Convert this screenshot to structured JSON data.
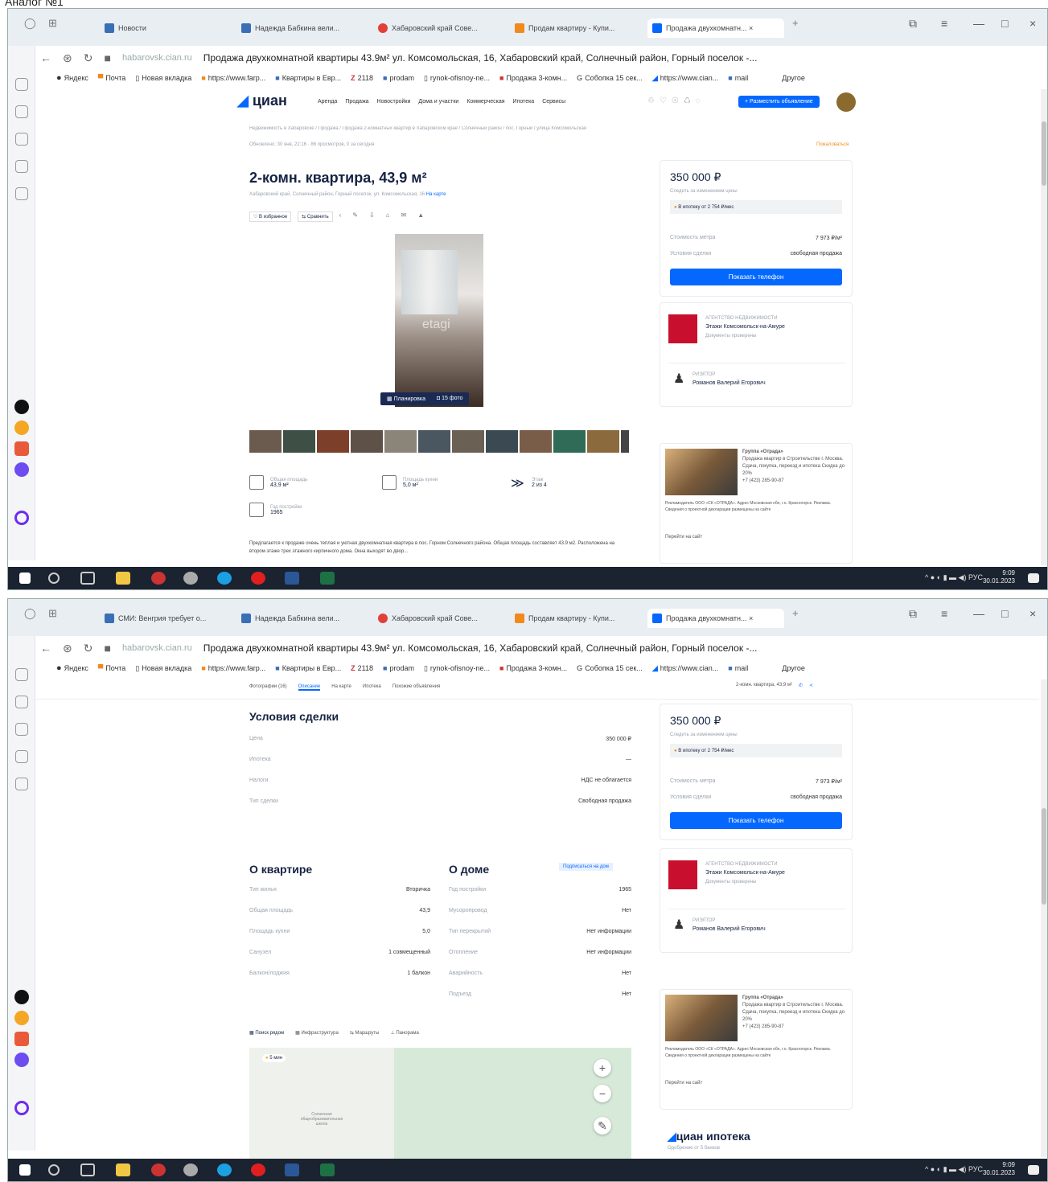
{
  "caption": "Аналог №1",
  "browser": {
    "tabs_top": [
      "Новости",
      "Надежда Бабкина вели...",
      "Хабаровский край Сове...",
      "Продам квартиру - Купи...",
      "Продажа двухкомнатн... ×"
    ],
    "tabs_bottom": [
      "СМИ: Венгрия требует о...",
      "Надежда Бабкина вели...",
      "Хабаровский край Сове...",
      "Продам квартиру - Купи...",
      "Продажа двухкомнатн... ×"
    ],
    "url_host": "habarovsk.cian.ru",
    "url_title": "Продажа двухкомнатной квартиры 43.9м² ул. Комсомольская, 16, Хабаровский край, Солнечный район, Горный поселок -...",
    "bookmarks": [
      "Яндекс",
      "Почта",
      "Новая вкладка",
      "https://www.farp...",
      "Квартиры в Евр...",
      "2118",
      "prodam",
      "rynok-ofisnoy-ne...",
      "Продажа 3-комн...",
      "Собопка 15 сек...",
      "https://www.cian...",
      "mail"
    ],
    "bookmarks_other": "Другое",
    "plus_tab": "+",
    "win_controls": [
      "—",
      "□",
      "×"
    ]
  },
  "taskbar": {
    "lang": "РУС",
    "time": "9:09",
    "date": "30.01.2023"
  },
  "cian": {
    "logo": "циан",
    "nav": [
      "Аренда",
      "Продажа",
      "Новостройки",
      "Дома и участки",
      "Коммерческая",
      "Ипотека",
      "Сервисы"
    ],
    "post_button": "+ Разместить объявление",
    "breadcrumb": "Недвижимость в Хабаровске / Продажа / Продажа 2-комнатных квартир в Хабаровском крае / Солнечный район / пос. Горный / улица Комсомольская",
    "published": "Обновлено: 30 янв, 22:16 · 86 просмотров, 0 за сегодня",
    "report": "Пожаловаться",
    "title": "2-комн. квартира, 43,9 м²",
    "address": "Хабаровский край, Солнечный район, Горный поселок, ул. Комсомольская, 16",
    "map_link": "На карте",
    "actions": [
      "В избранное",
      "Сравнить"
    ],
    "photo_watermark": "etagi",
    "photo_buttons": [
      "Планировка",
      "15 фото"
    ],
    "stats": [
      {
        "label": "Общая площадь",
        "value": "43,9 м²"
      },
      {
        "label": "Площадь кухни",
        "value": "5,0 м²"
      },
      {
        "label": "Этаж",
        "value": "2 из 4"
      },
      {
        "label": "Год постройки",
        "value": "1965"
      }
    ],
    "description": "Предлагается к продаже очень теплая и уютная двухкомнатная квартира в пос. Горном Солнечного района. Общая площадь составляет 43.9 м2. Расположена на втором этаже трех этажного кирпичного дома. Окна выходят во двор...",
    "price": "350 000 ₽",
    "price_watch": "Следить за изменением цены",
    "mortgage": "В ипотеку от 2 754 ₽/мес",
    "price_per_m": "Стоимость метра",
    "price_per_m_value": "7 973 ₽/м²",
    "conditions": "Условия сделки",
    "conditions_value": "свободная продажа",
    "show_phone": "Показать телефон",
    "agency_label": "АГЕНТСТВО НЕДВИЖИМОСТИ",
    "agency_name": "Этажи Комсомольск-на-Амуре",
    "agency_docs": "Документы проверены",
    "realtor_label": "РИЭЛТОР",
    "realtor_name": "Романов Валерий Егорович",
    "ad_title": "Группа «Отрада»",
    "ad_text": "Продажа квартир в Строительстве г. Москва. Сдача, покупка, переезд и ипотека Скидка до 20%",
    "ad_phone": "+7 (423) 285-90-87",
    "ad_link": "Перейти на сайт",
    "ad_small": "Рекламодатель ООО «СК «ОТРАДА». Адрес Московская обл, г.о. Красногорск. Реклама. Сведения о проектной декларации размещены на сайте",
    "sticky_tabs": [
      "Фотографии (16)",
      "Описание",
      "На карте",
      "Ипотека",
      "Похожие объявления"
    ],
    "sticky_right": "2-комн. квартира, 43,9 м²",
    "deal_title": "Условия сделки",
    "deal_rows": [
      [
        "Цена",
        "350 000 ₽"
      ],
      [
        "Ипотека",
        "—"
      ],
      [
        "Налоги",
        "НДС не облагается"
      ],
      [
        "Тип сделки",
        "Свободная продажа"
      ]
    ],
    "flat_title": "О квартире",
    "flat_rows": [
      [
        "Тип жилья",
        "Вторичка"
      ],
      [
        "Общая площадь",
        "43,9"
      ],
      [
        "Площадь кухни",
        "5,0"
      ],
      [
        "Санузел",
        "1 совмещенный"
      ],
      [
        "Балкон/лоджия",
        "1 балкон"
      ]
    ],
    "house_title": "О доме",
    "house_badge": "Подписаться на дом",
    "house_rows": [
      [
        "Год постройки",
        "1965"
      ],
      [
        "Мусоропровод",
        "Нет"
      ],
      [
        "Тип перекрытий",
        "Нет информации"
      ],
      [
        "Отопление",
        "Нет информации"
      ],
      [
        "Аварийность",
        "Нет"
      ],
      [
        "Подъезд",
        "Нет"
      ]
    ],
    "map_tabs": [
      "Поиск рядом",
      "Инфраструктура",
      "Маршруты",
      "Панорама"
    ],
    "map_badge": "5 мин",
    "map_label": "Солнечная общеобразовательная школа",
    "cian_ipoteka": "циан ипотека",
    "cian_ipoteka_sub": "Одобрение от 5 банков"
  },
  "colors": {
    "accent": "#0468ff",
    "text": "#152242",
    "taskbar": "#1b2330"
  }
}
